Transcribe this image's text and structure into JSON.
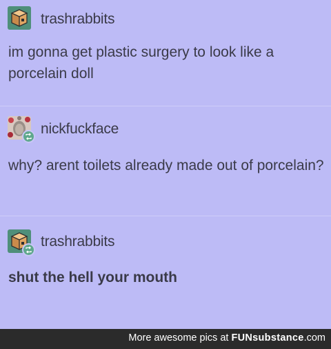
{
  "posts": [
    {
      "username": "trashrabbits",
      "text": "im gonna get plastic surgery to look like a porcelain doll",
      "avatar": "box-avatar-icon",
      "reblog": false
    },
    {
      "username": "nickfuckface",
      "text": "why? arent toilets already made out of porcelain?",
      "avatar": "photo-avatar-icon",
      "reblog": true
    },
    {
      "username": "trashrabbits",
      "text": "shut the hell your mouth",
      "avatar": "box-avatar-icon",
      "reblog": true
    }
  ],
  "footer": {
    "prefix": "More awesome pics at ",
    "brand_bold": "FUN",
    "brand_rest": "substance",
    "brand_suffix": ".com"
  },
  "colors": {
    "background": "#bdbbf6",
    "text": "#3a3a48",
    "reblog_badge": "#5fa88d",
    "footer_bg": "#2b2b2b"
  }
}
